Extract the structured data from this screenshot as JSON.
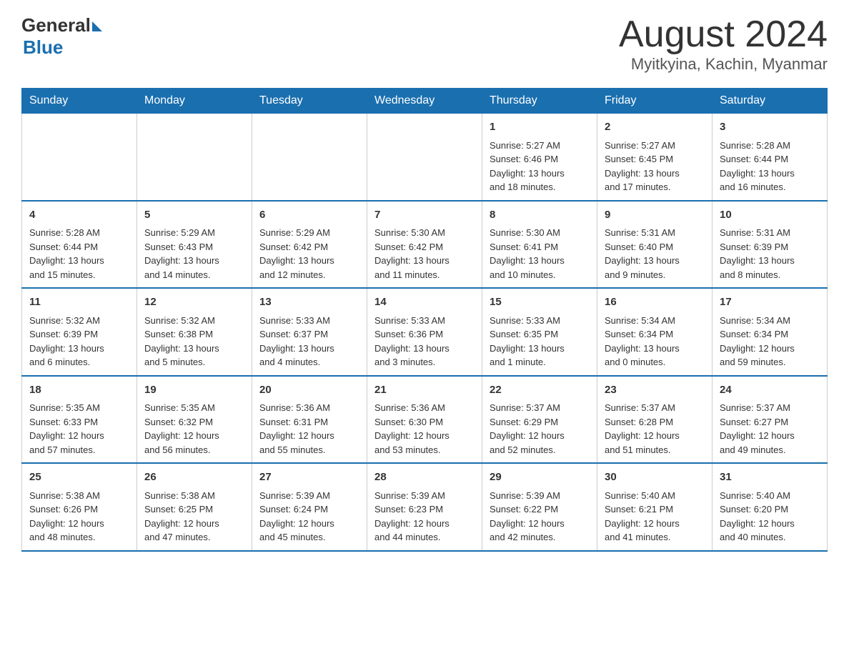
{
  "logo": {
    "general": "General",
    "blue": "Blue"
  },
  "title": "August 2024",
  "location": "Myitkyina, Kachin, Myanmar",
  "days_of_week": [
    "Sunday",
    "Monday",
    "Tuesday",
    "Wednesday",
    "Thursday",
    "Friday",
    "Saturday"
  ],
  "weeks": [
    [
      {
        "day": "",
        "info": ""
      },
      {
        "day": "",
        "info": ""
      },
      {
        "day": "",
        "info": ""
      },
      {
        "day": "",
        "info": ""
      },
      {
        "day": "1",
        "info": "Sunrise: 5:27 AM\nSunset: 6:46 PM\nDaylight: 13 hours\nand 18 minutes."
      },
      {
        "day": "2",
        "info": "Sunrise: 5:27 AM\nSunset: 6:45 PM\nDaylight: 13 hours\nand 17 minutes."
      },
      {
        "day": "3",
        "info": "Sunrise: 5:28 AM\nSunset: 6:44 PM\nDaylight: 13 hours\nand 16 minutes."
      }
    ],
    [
      {
        "day": "4",
        "info": "Sunrise: 5:28 AM\nSunset: 6:44 PM\nDaylight: 13 hours\nand 15 minutes."
      },
      {
        "day": "5",
        "info": "Sunrise: 5:29 AM\nSunset: 6:43 PM\nDaylight: 13 hours\nand 14 minutes."
      },
      {
        "day": "6",
        "info": "Sunrise: 5:29 AM\nSunset: 6:42 PM\nDaylight: 13 hours\nand 12 minutes."
      },
      {
        "day": "7",
        "info": "Sunrise: 5:30 AM\nSunset: 6:42 PM\nDaylight: 13 hours\nand 11 minutes."
      },
      {
        "day": "8",
        "info": "Sunrise: 5:30 AM\nSunset: 6:41 PM\nDaylight: 13 hours\nand 10 minutes."
      },
      {
        "day": "9",
        "info": "Sunrise: 5:31 AM\nSunset: 6:40 PM\nDaylight: 13 hours\nand 9 minutes."
      },
      {
        "day": "10",
        "info": "Sunrise: 5:31 AM\nSunset: 6:39 PM\nDaylight: 13 hours\nand 8 minutes."
      }
    ],
    [
      {
        "day": "11",
        "info": "Sunrise: 5:32 AM\nSunset: 6:39 PM\nDaylight: 13 hours\nand 6 minutes."
      },
      {
        "day": "12",
        "info": "Sunrise: 5:32 AM\nSunset: 6:38 PM\nDaylight: 13 hours\nand 5 minutes."
      },
      {
        "day": "13",
        "info": "Sunrise: 5:33 AM\nSunset: 6:37 PM\nDaylight: 13 hours\nand 4 minutes."
      },
      {
        "day": "14",
        "info": "Sunrise: 5:33 AM\nSunset: 6:36 PM\nDaylight: 13 hours\nand 3 minutes."
      },
      {
        "day": "15",
        "info": "Sunrise: 5:33 AM\nSunset: 6:35 PM\nDaylight: 13 hours\nand 1 minute."
      },
      {
        "day": "16",
        "info": "Sunrise: 5:34 AM\nSunset: 6:34 PM\nDaylight: 13 hours\nand 0 minutes."
      },
      {
        "day": "17",
        "info": "Sunrise: 5:34 AM\nSunset: 6:34 PM\nDaylight: 12 hours\nand 59 minutes."
      }
    ],
    [
      {
        "day": "18",
        "info": "Sunrise: 5:35 AM\nSunset: 6:33 PM\nDaylight: 12 hours\nand 57 minutes."
      },
      {
        "day": "19",
        "info": "Sunrise: 5:35 AM\nSunset: 6:32 PM\nDaylight: 12 hours\nand 56 minutes."
      },
      {
        "day": "20",
        "info": "Sunrise: 5:36 AM\nSunset: 6:31 PM\nDaylight: 12 hours\nand 55 minutes."
      },
      {
        "day": "21",
        "info": "Sunrise: 5:36 AM\nSunset: 6:30 PM\nDaylight: 12 hours\nand 53 minutes."
      },
      {
        "day": "22",
        "info": "Sunrise: 5:37 AM\nSunset: 6:29 PM\nDaylight: 12 hours\nand 52 minutes."
      },
      {
        "day": "23",
        "info": "Sunrise: 5:37 AM\nSunset: 6:28 PM\nDaylight: 12 hours\nand 51 minutes."
      },
      {
        "day": "24",
        "info": "Sunrise: 5:37 AM\nSunset: 6:27 PM\nDaylight: 12 hours\nand 49 minutes."
      }
    ],
    [
      {
        "day": "25",
        "info": "Sunrise: 5:38 AM\nSunset: 6:26 PM\nDaylight: 12 hours\nand 48 minutes."
      },
      {
        "day": "26",
        "info": "Sunrise: 5:38 AM\nSunset: 6:25 PM\nDaylight: 12 hours\nand 47 minutes."
      },
      {
        "day": "27",
        "info": "Sunrise: 5:39 AM\nSunset: 6:24 PM\nDaylight: 12 hours\nand 45 minutes."
      },
      {
        "day": "28",
        "info": "Sunrise: 5:39 AM\nSunset: 6:23 PM\nDaylight: 12 hours\nand 44 minutes."
      },
      {
        "day": "29",
        "info": "Sunrise: 5:39 AM\nSunset: 6:22 PM\nDaylight: 12 hours\nand 42 minutes."
      },
      {
        "day": "30",
        "info": "Sunrise: 5:40 AM\nSunset: 6:21 PM\nDaylight: 12 hours\nand 41 minutes."
      },
      {
        "day": "31",
        "info": "Sunrise: 5:40 AM\nSunset: 6:20 PM\nDaylight: 12 hours\nand 40 minutes."
      }
    ]
  ]
}
